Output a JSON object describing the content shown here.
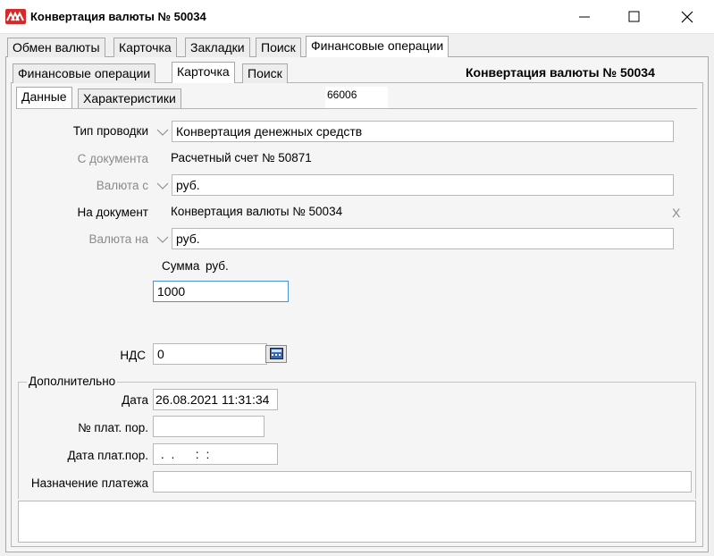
{
  "window": {
    "title": "Конвертация валюты № 50034"
  },
  "tabs_top": [
    "Обмен валюты",
    "Карточка",
    "Закладки",
    "Поиск",
    "Финансовые операции"
  ],
  "tabs_second": [
    "Финансовые операции",
    "Карточка",
    "Поиск"
  ],
  "tabs_third": [
    "Данные",
    "Характеристики"
  ],
  "card": {
    "header": "Конвертация валюты № 50034",
    "number": "66006"
  },
  "form": {
    "entry_type_label": "Тип проводки",
    "entry_type_value": "Конвертация денежных средств",
    "from_doc_label": "С документа",
    "from_doc_value": "Расчетный счет № 50871",
    "currency_from_label": "Валюта с",
    "currency_from_value": "руб.",
    "to_doc_label": "На документ",
    "to_doc_value": "Конвертация валюты № 50034",
    "clear_label": "X",
    "currency_to_label": "Валюта на",
    "currency_to_value": "руб.",
    "sum_label": "Сумма",
    "sum_currency": "руб.",
    "sum_value": "1000",
    "vat_label": "НДС",
    "vat_value": "0"
  },
  "additional": {
    "group_label": "Дополнительно",
    "date_label": "Дата",
    "date_value": "26.08.2021 11:31:34",
    "payment_no_label": "№ плат. пор.",
    "payment_no_value": "",
    "payment_date_label": "Дата плат.пор.",
    "payment_date_value": " .  .      :  :",
    "purpose_label": "Назначение платежа",
    "purpose_value": ""
  },
  "colors": {
    "accent": "#4a90d9",
    "icon_red": "#d42a2a",
    "disabled_text": "#8a8a8a"
  }
}
